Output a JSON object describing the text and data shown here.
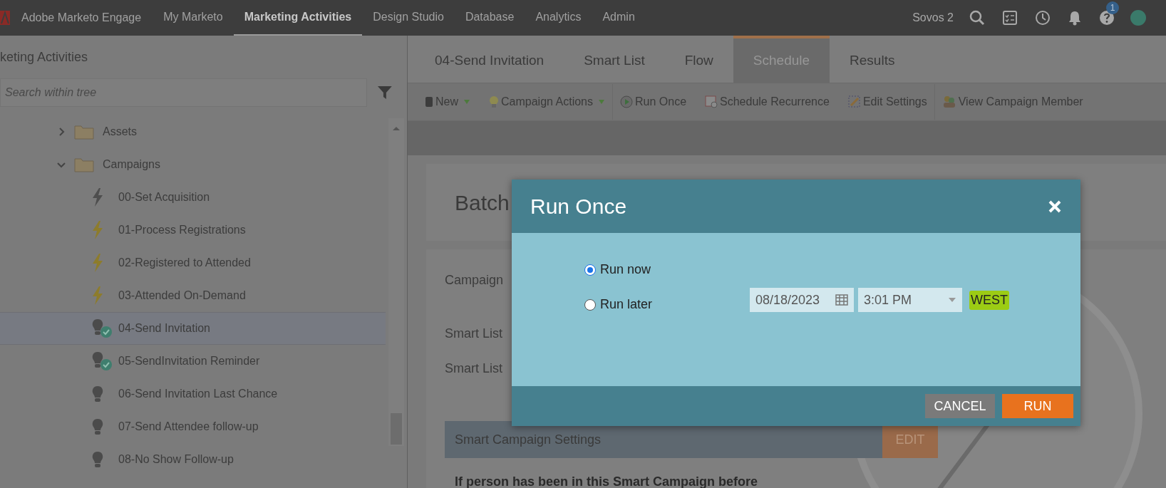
{
  "topbar": {
    "product": "Adobe Marketo Engage",
    "nav": [
      {
        "label": "My Marketo",
        "selected": false
      },
      {
        "label": "Marketing Activities",
        "selected": true
      },
      {
        "label": "Design Studio",
        "selected": false
      },
      {
        "label": "Database",
        "selected": false
      },
      {
        "label": "Analytics",
        "selected": false
      },
      {
        "label": "Admin",
        "selected": false
      }
    ],
    "workspace": "Sovos 2",
    "help_badge": "1"
  },
  "sidebar": {
    "title": "keting Activities",
    "search": {
      "placeholder": "Search within tree"
    },
    "tree": [
      {
        "label": "Assets",
        "kind": "folder",
        "expanded": false,
        "selected": false
      },
      {
        "label": "Campaigns",
        "kind": "folder",
        "expanded": true,
        "selected": false,
        "children": [
          {
            "label": "00-Set Acquisition",
            "kind": "trigger",
            "active": false,
            "selected": false
          },
          {
            "label": "01-Process Registrations",
            "kind": "trigger",
            "active": true,
            "selected": false
          },
          {
            "label": "02-Registered to Attended",
            "kind": "trigger",
            "active": true,
            "selected": false
          },
          {
            "label": "03-Attended On-Demand",
            "kind": "trigger",
            "active": true,
            "selected": false
          },
          {
            "label": "04-Send Invitation",
            "kind": "batch",
            "active": true,
            "selected": true
          },
          {
            "label": "05-SendInvitation Reminder",
            "kind": "batch",
            "active": true,
            "selected": false
          },
          {
            "label": "06-Send Invitation Last Chance",
            "kind": "batch",
            "active": false,
            "selected": false
          },
          {
            "label": "07-Send Attendee follow-up",
            "kind": "batch",
            "active": false,
            "selected": false
          },
          {
            "label": "08-No Show Follow-up",
            "kind": "batch",
            "active": false,
            "selected": false
          }
        ]
      }
    ]
  },
  "tabs": [
    {
      "label": "04-Send Invitation",
      "selected": false
    },
    {
      "label": "Smart List",
      "selected": false
    },
    {
      "label": "Flow",
      "selected": false
    },
    {
      "label": "Schedule",
      "selected": true
    },
    {
      "label": "Results",
      "selected": false
    }
  ],
  "toolbar": [
    {
      "label": "New",
      "kind": "new",
      "menu": true
    },
    {
      "label": "Campaign Actions",
      "kind": "actions",
      "menu": true
    },
    {
      "label": "Run Once",
      "kind": "run",
      "menu": false
    },
    {
      "label": "Schedule Recurrence",
      "kind": "recurrence",
      "menu": false
    },
    {
      "label": "Edit Settings",
      "kind": "edit",
      "menu": false
    },
    {
      "label": "View Campaign Member",
      "kind": "members",
      "menu": false
    }
  ],
  "content": {
    "card_title": "Batch",
    "fields": [
      "Campaign",
      "Smart List",
      "Smart List"
    ],
    "settings_header": "Smart Campaign Settings",
    "edit_button": "EDIT",
    "settings_line": "If person has been in this Smart Campaign before"
  },
  "dialog": {
    "title": "Run Once",
    "options": [
      {
        "label": "Run now",
        "selected": true
      },
      {
        "label": "Run later",
        "selected": false
      }
    ],
    "date": "08/18/2023",
    "time": "3:01 PM",
    "timezone": "WEST",
    "buttons": [
      {
        "label": "CANCEL",
        "kind": "secondary"
      },
      {
        "label": "RUN",
        "kind": "primary"
      }
    ]
  }
}
